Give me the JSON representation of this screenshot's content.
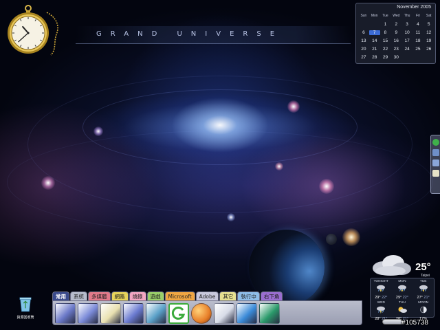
{
  "desktop": {
    "title_bar_text": "GRAND UNIVERSE"
  },
  "clock": {
    "hour": 10,
    "minute": 38
  },
  "calendar": {
    "month_label": "November 2005",
    "weekdays": [
      "Sun",
      "Mon",
      "Tue",
      "Wed",
      "Thu",
      "Fri",
      "Sat"
    ],
    "weeks": [
      [
        "",
        "",
        "1",
        "2",
        "3",
        "4",
        "5"
      ],
      [
        "6",
        "7",
        "8",
        "9",
        "10",
        "11",
        "12"
      ],
      [
        "13",
        "14",
        "15",
        "16",
        "17",
        "18",
        "19"
      ],
      [
        "20",
        "21",
        "22",
        "23",
        "24",
        "25",
        "26"
      ],
      [
        "27",
        "28",
        "29",
        "30",
        "",
        "",
        ""
      ]
    ],
    "today": "7",
    "today_color": "#3c6cd6"
  },
  "weather": {
    "current_temp": "25°",
    "city": "Taipei",
    "forecast_top": [
      {
        "label": "TONIGHT",
        "high": "29°",
        "low": "22°",
        "icon": "storm-icon"
      },
      {
        "label": "MON",
        "high": "29°",
        "low": "22°",
        "icon": "storm-icon"
      },
      {
        "label": "TUE",
        "high": "27°",
        "low": "21°",
        "icon": "storm-icon"
      }
    ],
    "forecast_bottom": [
      {
        "label": "WED",
        "high": "28°",
        "low": "21°",
        "icon": "storm-icon"
      },
      {
        "label": "THU",
        "high": "28°",
        "low": "21°",
        "icon": "sun-cloud-icon"
      },
      {
        "label": "MOON",
        "high": "17%",
        "low": "",
        "icon": "moon-icon"
      }
    ]
  },
  "recycle_bin": {
    "label": "資源回收筒"
  },
  "dock": {
    "tabs": [
      {
        "label": "常用",
        "color": "#3a4a8c",
        "active": true
      },
      {
        "label": "系統",
        "color": "#b7bccc",
        "active": false
      },
      {
        "label": "多媒體",
        "color": "#e27a8a",
        "active": false
      },
      {
        "label": "網路",
        "color": "#e7d45a",
        "active": false
      },
      {
        "label": "燒錄",
        "color": "#f3a6c3",
        "active": false
      },
      {
        "label": "遊戲",
        "color": "#9ad06a",
        "active": false
      },
      {
        "label": "Microsoft",
        "color": "#f0a642",
        "active": false
      },
      {
        "label": "Adobe",
        "color": "#c8c8dc",
        "active": false
      },
      {
        "label": "其它",
        "color": "#e6e090",
        "active": false
      },
      {
        "label": "執行中",
        "color": "#8fbde8",
        "active": false
      },
      {
        "label": "右下角",
        "color": "#9a6ed0",
        "active": false
      }
    ],
    "icons": [
      {
        "name": "briefcase-icon",
        "color": "#6a78c8"
      },
      {
        "name": "folder-icon",
        "color": "#7a8ad8"
      },
      {
        "name": "notepad-icon",
        "color": "#e8e0b0"
      },
      {
        "name": "box-icon",
        "color": "#6a7ad0"
      },
      {
        "name": "network-tools-icon",
        "color": "#5aa0c8"
      },
      {
        "name": "g-app-icon",
        "color": "#3aaa3a"
      },
      {
        "name": "browser-icon",
        "color": "#e8802a"
      },
      {
        "name": "mail-icon",
        "color": "#d8dce8"
      },
      {
        "name": "shortcut-globe-icon",
        "color": "#3a8ad8"
      },
      {
        "name": "shortcut-network-icon",
        "color": "#2a9a6a"
      }
    ]
  },
  "side_launcher": {
    "icons": [
      "green-app-icon",
      "drive-icon",
      "window-icon",
      "doc-icon"
    ]
  },
  "watermark": "#105738"
}
